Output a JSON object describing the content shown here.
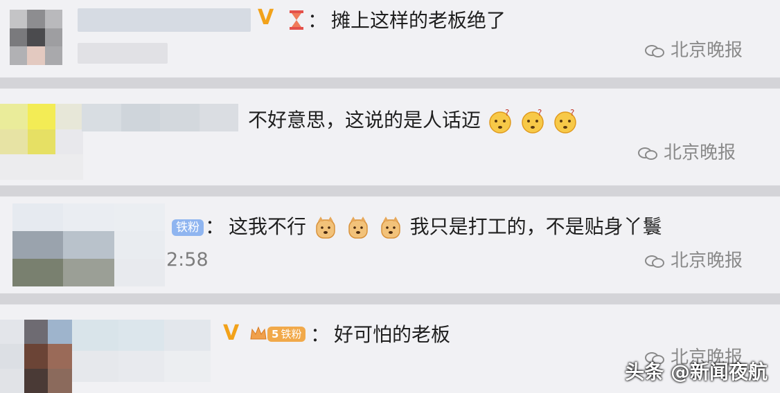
{
  "comments": [
    {
      "text": "摊上这样的老板绝了",
      "colon": "："
    },
    {
      "text": "不好意思，这说的是人话迈",
      "emojis": [
        "confused-emoji",
        "confused-emoji",
        "confused-emoji"
      ]
    },
    {
      "badge": "铁粉",
      "colon": "：",
      "text_before": "这我不行",
      "text_after": "我只是打工的，不是贴身丫鬟",
      "emojis": [
        "dog-emoji",
        "dog-emoji",
        "dog-emoji"
      ],
      "time": "2:58"
    },
    {
      "badge": "铁粉",
      "badge_level": "5",
      "colon": "：",
      "text": "好可怕的老板"
    }
  ],
  "watermark": "北京晚报",
  "footer": "头条 @新闻夜航",
  "colors": {
    "card_bg": "#f1f1f4",
    "separator": "#d4d4d8",
    "vip_gold": "#f2a21a",
    "tiefen_badge": "#8fb5f0"
  }
}
